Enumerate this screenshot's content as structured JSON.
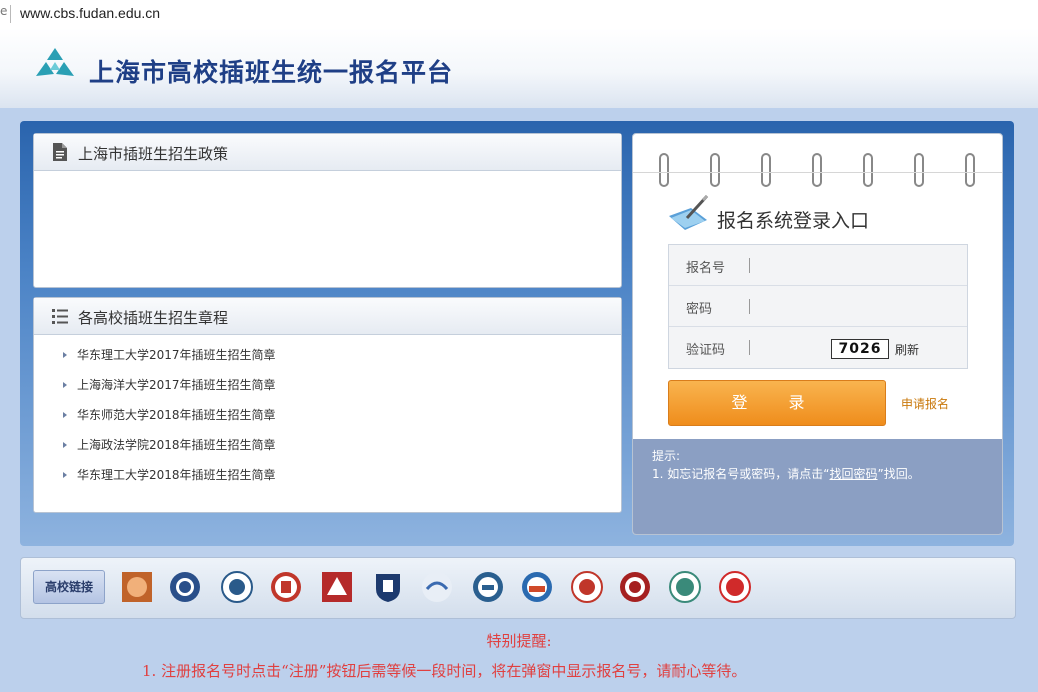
{
  "browser": {
    "url": "www.cbs.fudan.edu.cn"
  },
  "header": {
    "title": "上海市高校插班生统一报名平台"
  },
  "policy_panel": {
    "title": "上海市插班生招生政策"
  },
  "rules_panel": {
    "title": "各高校插班生招生章程",
    "items": [
      "华东理工大学2017年插班生招生简章",
      "上海海洋大学2017年插班生招生简章",
      "华东师范大学2018年插班生招生简章",
      "上海政法学院2018年插班生招生简章",
      "华东理工大学2018年插班生招生简章"
    ]
  },
  "login": {
    "title": "报名系统登录入口",
    "username_label": "报名号",
    "password_label": "密码",
    "captcha_label": "验证码",
    "captcha_value": "7026",
    "refresh_label": "刷新",
    "login_button": "登 录",
    "register_link": "申请报名",
    "tips_title": "提示:",
    "tips_pre": "1. 如忘记报名号或密码，请点击“",
    "tips_link": "找回密码",
    "tips_post": "”找回。"
  },
  "links_bar": {
    "label": "高校链接"
  },
  "notice": {
    "title": "特别提醒:",
    "line1": "1.  注册报名号时点击“注册”按钮后需等候一段时间，将在弹窗中显示报名号，请耐心等待。"
  },
  "colors": {
    "accent": "#1f3f86",
    "button": "#ef8d1c",
    "notice": "#e04040"
  }
}
